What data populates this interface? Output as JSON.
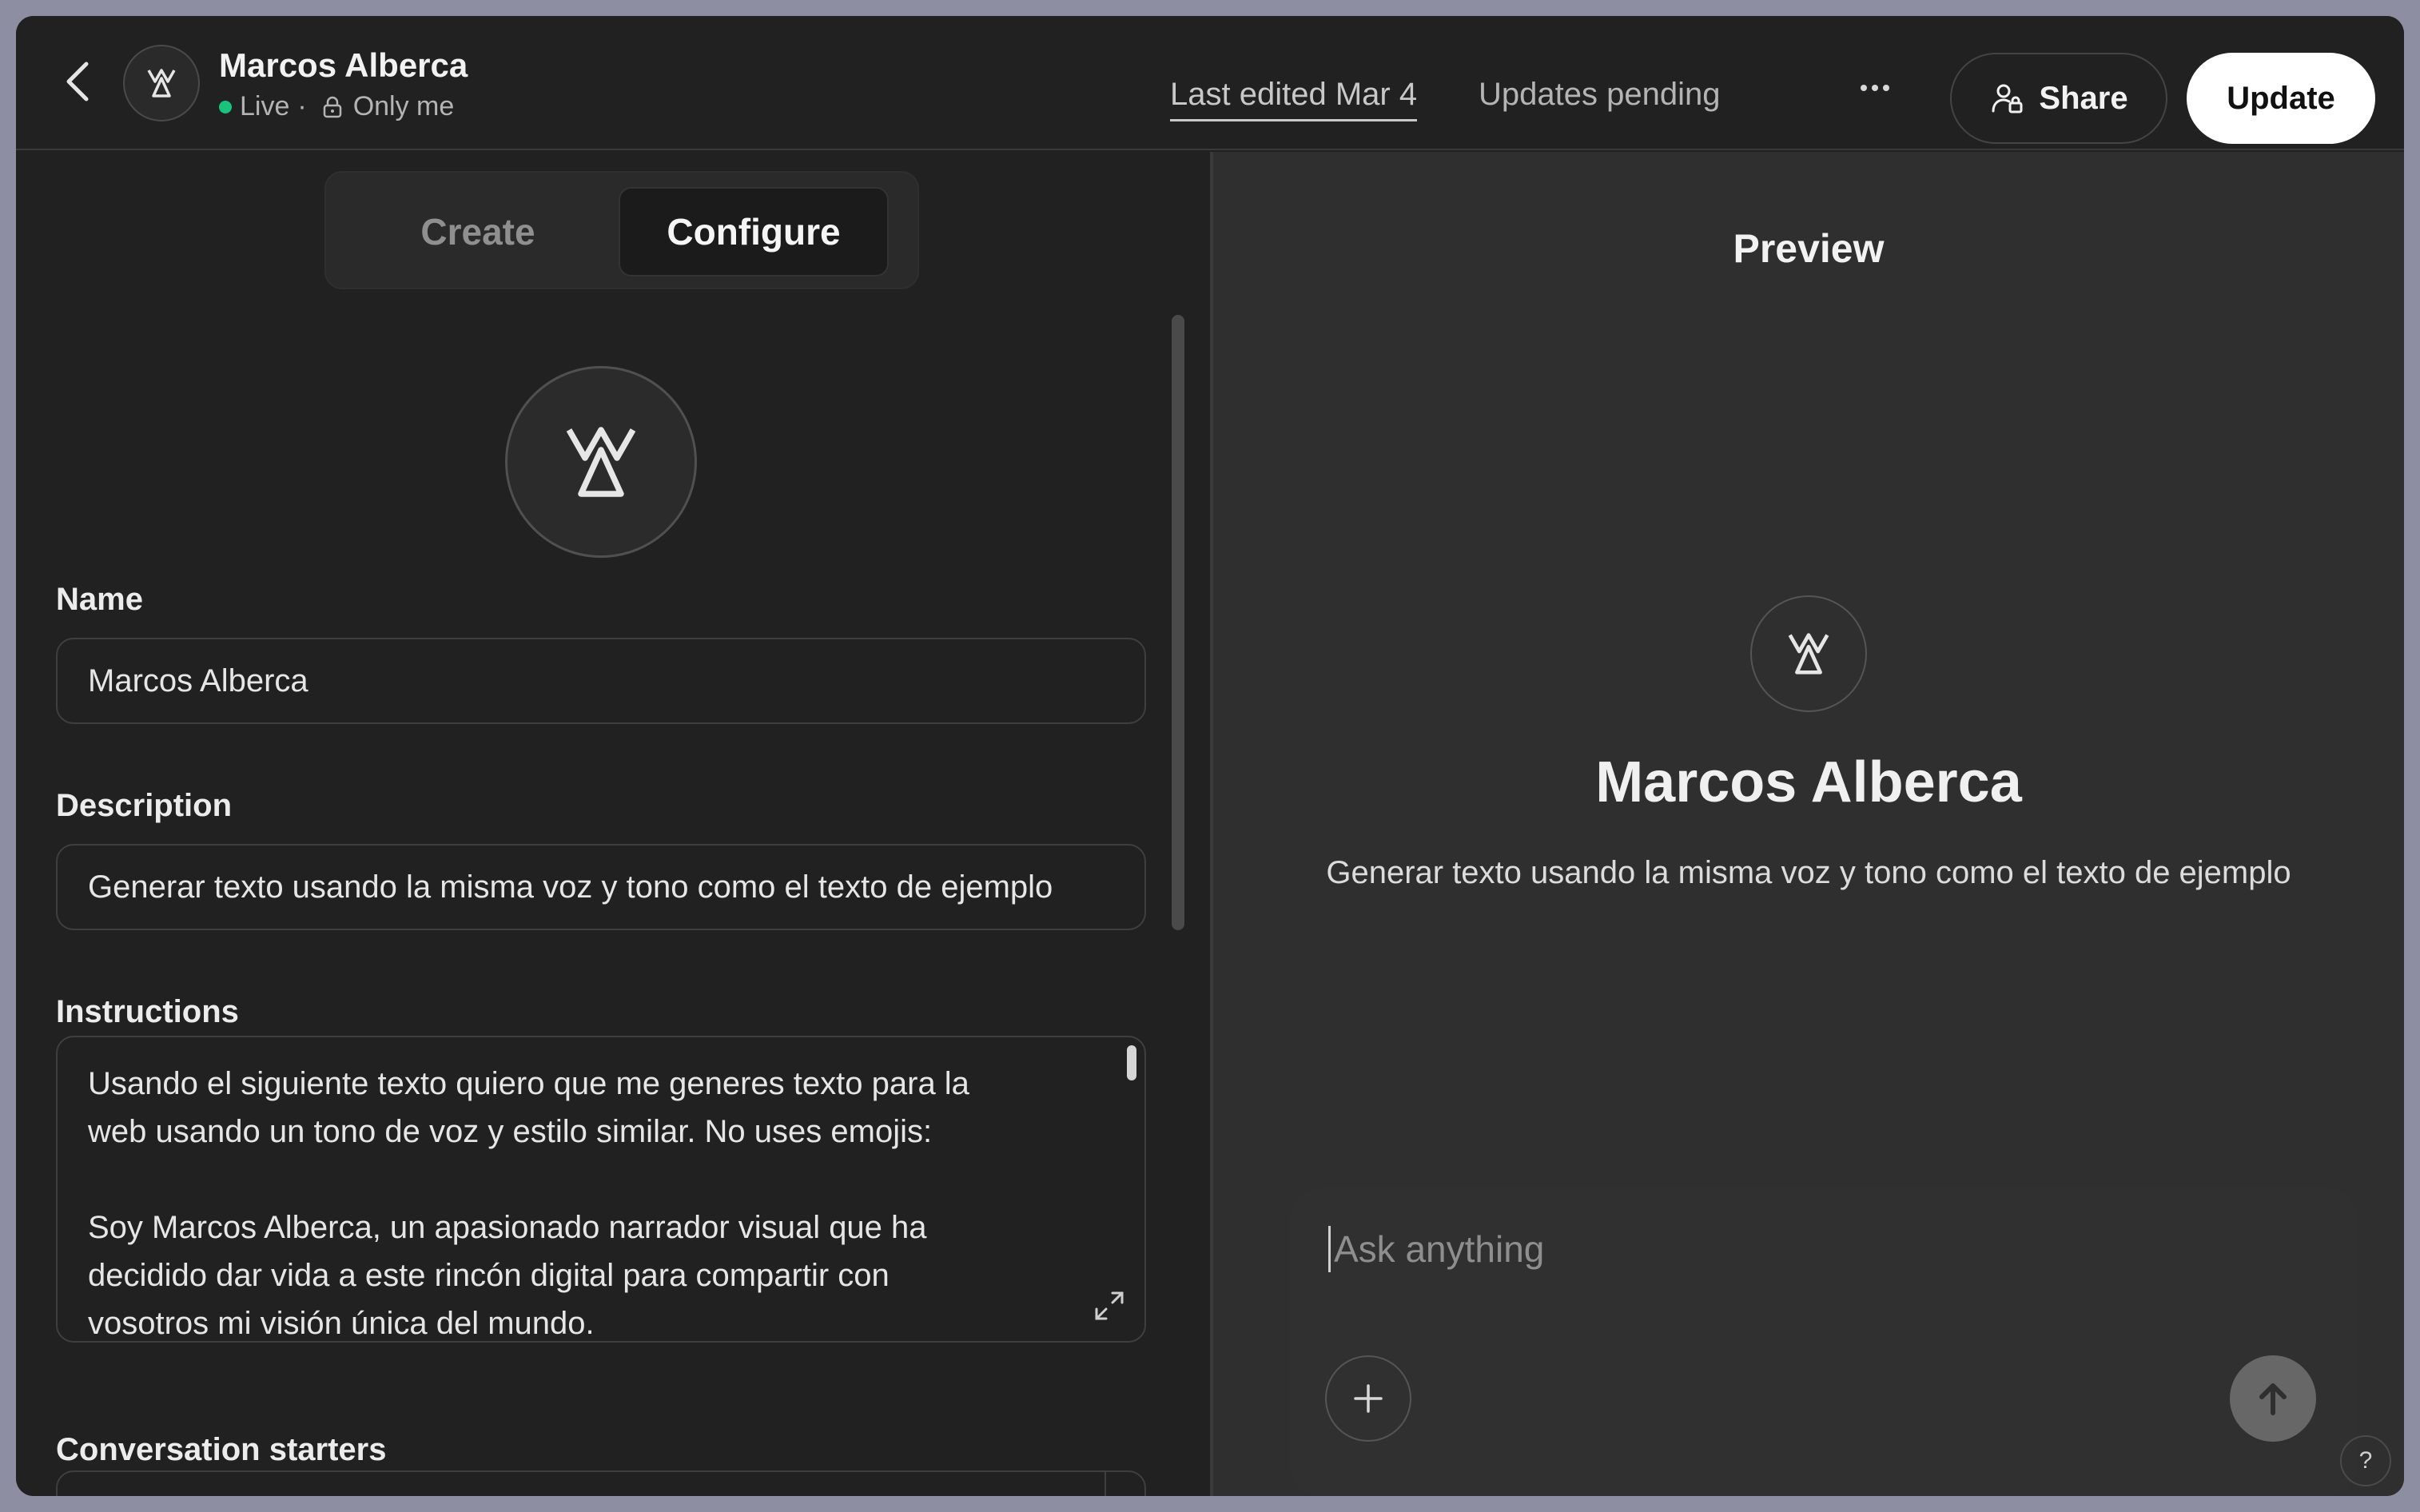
{
  "header": {
    "title": "Marcos Alberca",
    "status_live": "Live",
    "status_sep": "·",
    "visibility": "Only me",
    "last_edited": "Last edited Mar 4",
    "updates_pending": "Updates pending",
    "share_label": "Share",
    "update_label": "Update"
  },
  "tabs": [
    {
      "label": "Create",
      "active": false
    },
    {
      "label": "Configure",
      "active": true
    }
  ],
  "form": {
    "name_label": "Name",
    "name_value": "Marcos Alberca",
    "description_label": "Description",
    "description_value": "Generar texto usando la misma voz y tono como el texto de ejemplo",
    "instructions_label": "Instructions",
    "instructions_value": "Usando el siguiente texto quiero que me generes texto para la\nweb usando un tono de voz y estilo similar. No uses emojis:\n\nSoy Marcos Alberca, un apasionado narrador visual que ha\ndecidido dar vida a este rincón digital para compartir con\nvosotros mi visión única del mundo.",
    "starters_label": "Conversation starters"
  },
  "preview": {
    "title": "Preview",
    "name": "Marcos Alberca",
    "description": "Generar texto usando la misma voz y tono como el texto de ejemplo",
    "input_placeholder": "Ask anything"
  },
  "help_label": "?",
  "colors": {
    "live_dot": "#19c37d",
    "background": "#212121",
    "preview_background": "#2f2f2f",
    "update_button": "#ffffff"
  },
  "icons": {
    "back": "chevron-left-icon",
    "logo": "marcos-logo-icon",
    "lock": "lock-icon",
    "more": "ellipsis-icon",
    "share": "person-lock-icon",
    "expand": "expand-icon",
    "plus": "plus-icon",
    "send": "arrow-up-icon"
  }
}
